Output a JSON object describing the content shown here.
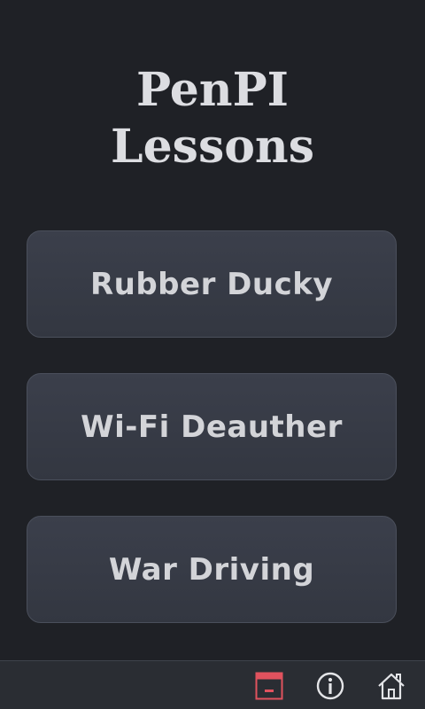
{
  "header": {
    "title_line1": "PenPI",
    "title_line2": "Lessons"
  },
  "lessons": [
    {
      "label": "Rubber Ducky"
    },
    {
      "label": "Wi-Fi Deauther"
    },
    {
      "label": "War Driving"
    }
  ],
  "bottom_bar": {
    "icons": [
      "minimize-window-icon",
      "info-icon",
      "home-icon"
    ],
    "minimize_color": "#e0525e"
  },
  "colors": {
    "background": "#1f2126",
    "button": "#383c47",
    "text": "#d3d4d8"
  }
}
